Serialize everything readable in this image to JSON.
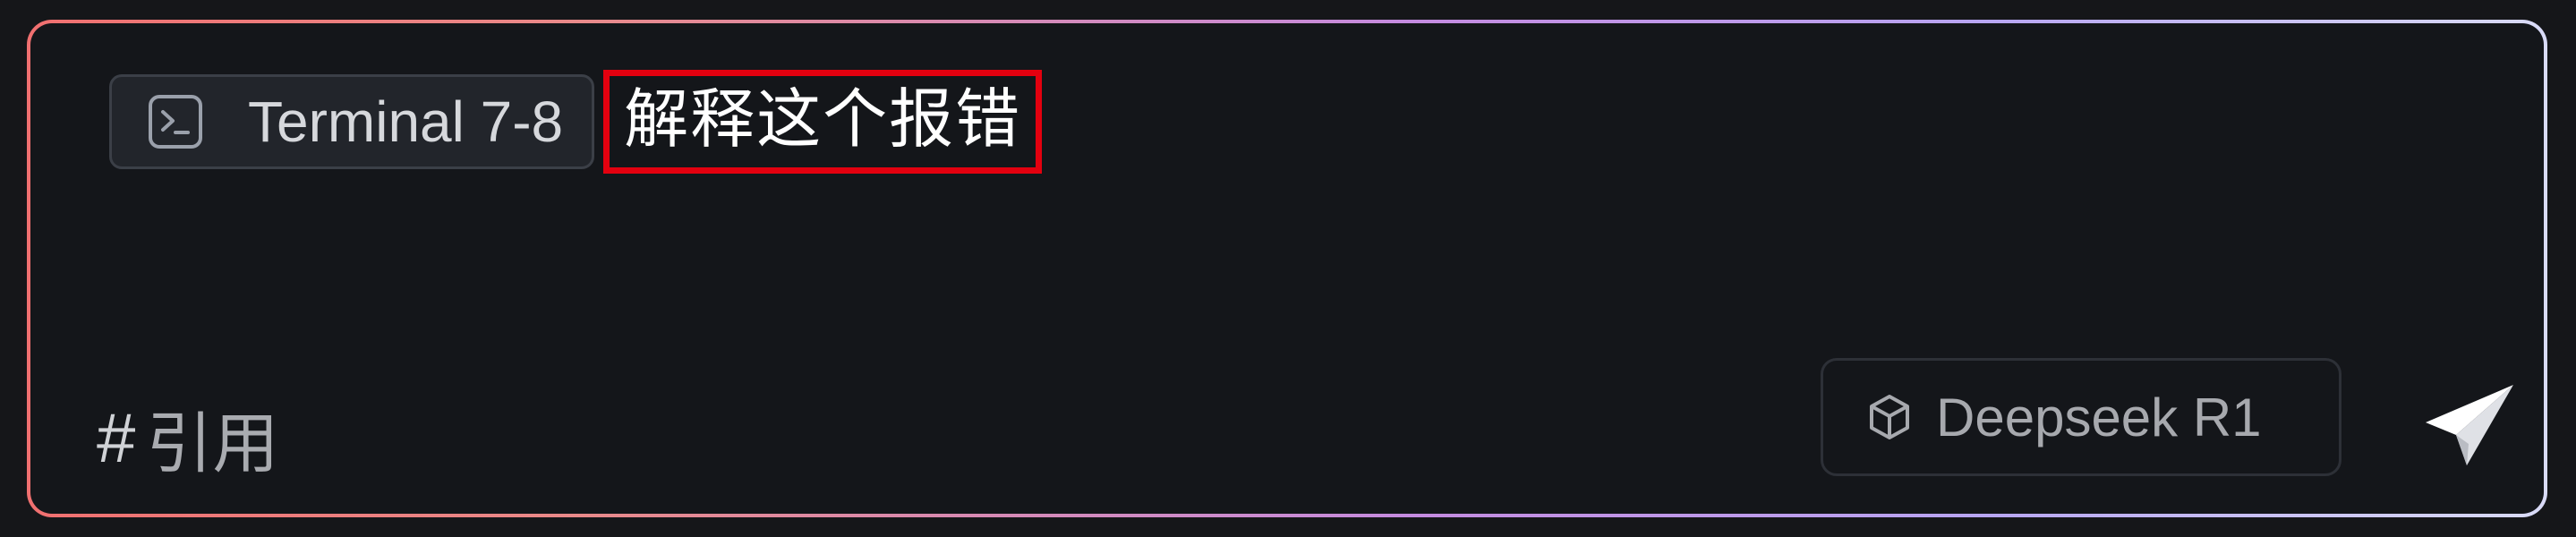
{
  "context_chip": {
    "label": "Terminal 7-8",
    "icon": "terminal-icon"
  },
  "message": {
    "text": "解释这个报错"
  },
  "reference": {
    "hash": "#",
    "label": "引用"
  },
  "model_selector": {
    "label": "Deepseek R1",
    "icon": "cube-icon"
  },
  "send": {
    "icon": "send-icon"
  },
  "colors": {
    "background": "#151619",
    "highlight_border": "#e3000f",
    "gradient_start": "#f07070",
    "gradient_end": "#d9dbf7"
  }
}
